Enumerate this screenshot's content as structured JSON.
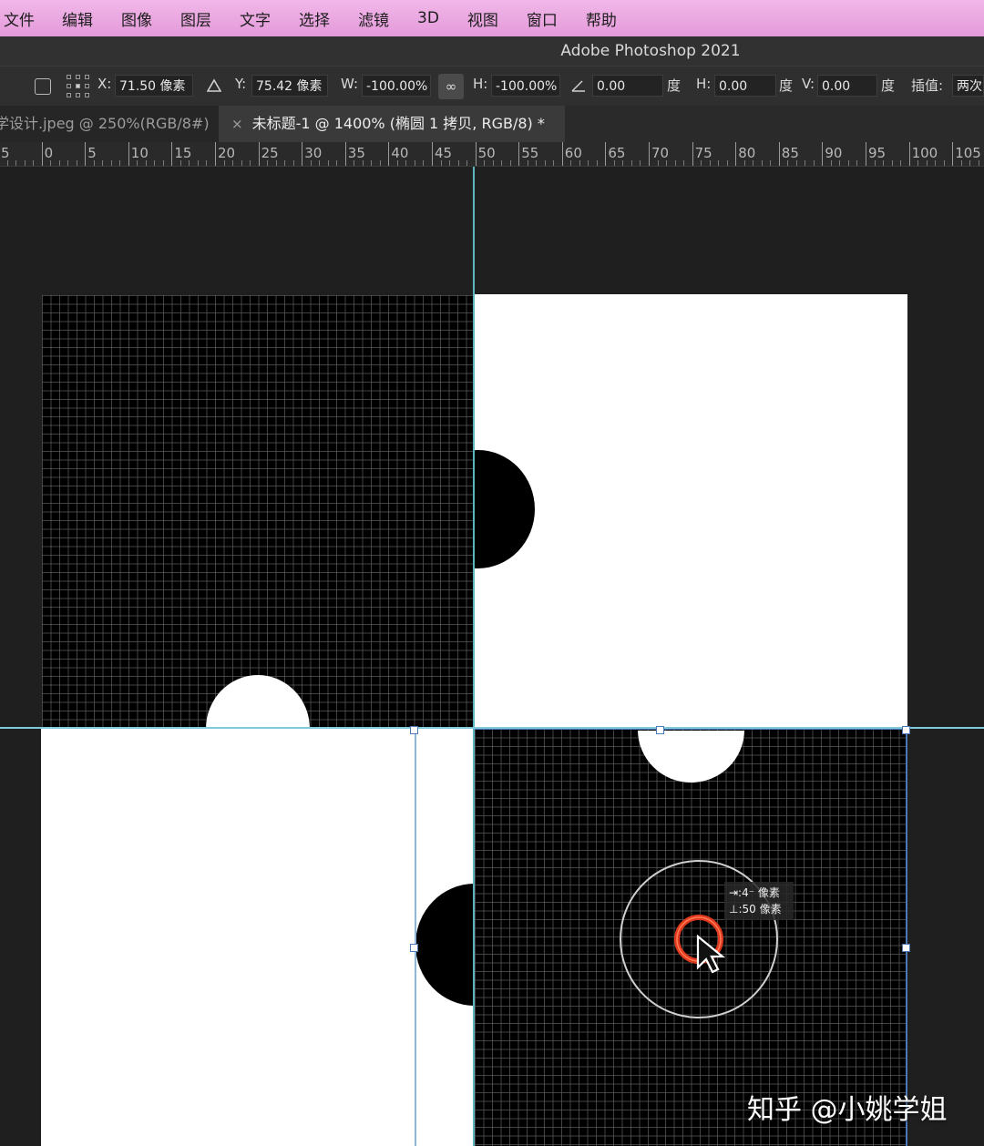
{
  "menu": [
    "文件",
    "编辑",
    "图像",
    "图层",
    "文字",
    "选择",
    "滤镜",
    "3D",
    "视图",
    "窗口",
    "帮助"
  ],
  "app_title": "Adobe Photoshop 2021",
  "options": {
    "x_label": "X:",
    "x_value": "71.50 像素",
    "y_label": "Y:",
    "y_value": "75.42 像素",
    "w_label": "W:",
    "w_value": "-100.00%",
    "link_glyph": "∞",
    "h_label": "H:",
    "h_value": "-100.00%",
    "angle_value": "0.00",
    "angle_unit": "度",
    "skew_h_label": "H:",
    "skew_h_value": "0.00",
    "skew_h_unit": "度",
    "skew_v_label": "V:",
    "skew_v_value": "0.00",
    "skew_v_unit": "度",
    "interp_label": "插值:",
    "interp_value": "两次"
  },
  "tabs": {
    "inactive": "学设计.jpeg @ 250%(RGB/8#)",
    "active_close": "×",
    "active": "未标题-1 @ 1400% (椭圆 1 拷贝, RGB/8) *"
  },
  "ruler_labels": [
    "5",
    "0",
    "5",
    "10",
    "15",
    "20",
    "25",
    "30",
    "35",
    "40",
    "45",
    "50",
    "55",
    "60",
    "65",
    "70",
    "75",
    "80",
    "85",
    "90",
    "95",
    "100",
    "105"
  ],
  "cursor_readout": {
    "line1": "⇥:4⁻ 像素",
    "line2": "⊥:50 像素"
  },
  "watermark": "知乎 @小姚学姐",
  "colors": {
    "menu_bar": "#eaa6e1",
    "guide": "#59b7c4",
    "cursor_ring": "#e03a1e",
    "bounding_box": "#4c79b8"
  },
  "icons": [
    "checkbox-icon",
    "reference-point-icon",
    "triangle-icon",
    "link-icon",
    "angle-icon",
    "arrow-cursor-icon"
  ]
}
